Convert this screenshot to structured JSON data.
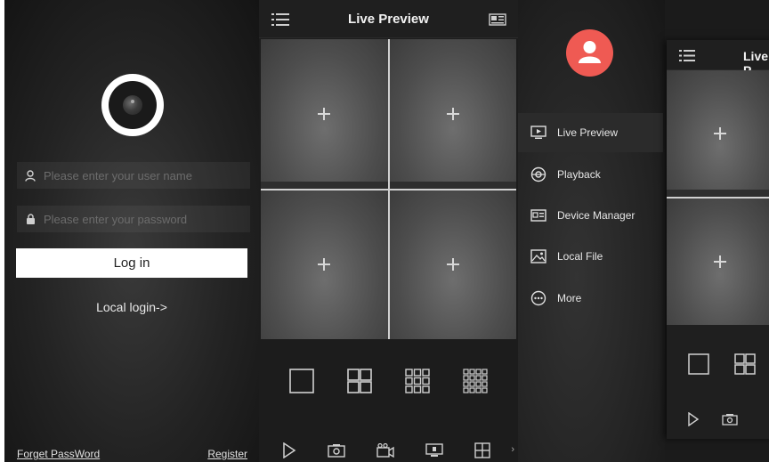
{
  "login": {
    "username_placeholder": "Please enter your user name",
    "password_placeholder": "Please enter your password",
    "login_label": "Log in",
    "local_login": "Local login->",
    "forget_password": "Forget PassWord",
    "register": "Register",
    "icons": [
      "app-logo-camera-icon",
      "user-icon",
      "lock-icon"
    ]
  },
  "live_preview": {
    "title": "Live Preview",
    "icons": {
      "left": "menu-list-icon",
      "right": "camera-list-icon"
    },
    "channels": [
      "+",
      "+",
      "+",
      "+"
    ],
    "layouts": [
      "1-split-icon",
      "4-split-icon",
      "9-split-icon",
      "16-split-icon"
    ],
    "controls": [
      "play-icon",
      "snapshot-icon",
      "record-icon",
      "device-icon",
      "split-icon"
    ],
    "more_indicator": "›"
  },
  "side_menu": {
    "items": [
      {
        "label": "Live Preview",
        "icon": "live-preview-icon",
        "active": true
      },
      {
        "label": "Playback",
        "icon": "playback-icon",
        "active": false
      },
      {
        "label": "Device Manager",
        "icon": "device-manager-icon",
        "active": false
      },
      {
        "label": "Local File",
        "icon": "local-file-icon",
        "active": false
      },
      {
        "label": "More",
        "icon": "more-icon",
        "active": false
      }
    ],
    "preview_title": "Live P",
    "avatar_icon": "user-avatar-icon"
  },
  "colors": {
    "avatar": "#ef5a53",
    "background": "#1c1c1c",
    "button": "#ffffff"
  }
}
